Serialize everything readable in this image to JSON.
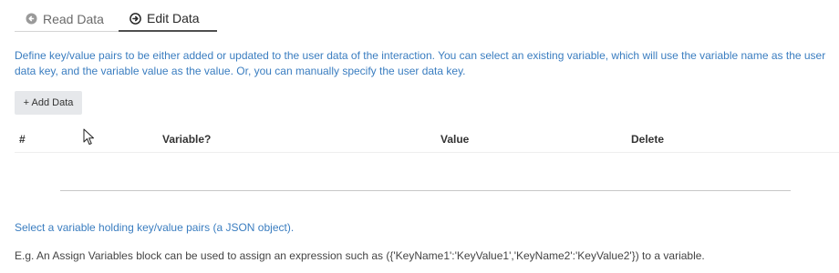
{
  "tabs": [
    {
      "label": "Read Data",
      "icon": "arrow-left-circle-icon",
      "active": false
    },
    {
      "label": "Edit Data",
      "icon": "arrow-right-circle-icon",
      "active": true
    }
  ],
  "description": {
    "line1": "Define key/value pairs to be either added or updated to the user data of the interaction. You can select an existing variable, which will use the variable name as the user",
    "line2": "data key, and the variable value as the value. Or, you can manually specify the user data key."
  },
  "add_button": {
    "label": "+ Add Data"
  },
  "table": {
    "columns": [
      "#",
      "Variable?",
      "Value",
      "Delete"
    ],
    "rows": []
  },
  "hint_variable": "Select a variable holding key/value pairs (a JSON object).",
  "hint_example": "E.g. An Assign Variables block can be used to assign an expression such as ({'KeyName1':'KeyValue1','KeyName2':'KeyValue2'}) to a variable.",
  "colors": {
    "link_blue": "#3a7dc0",
    "button_bg": "#e6e8eb"
  }
}
